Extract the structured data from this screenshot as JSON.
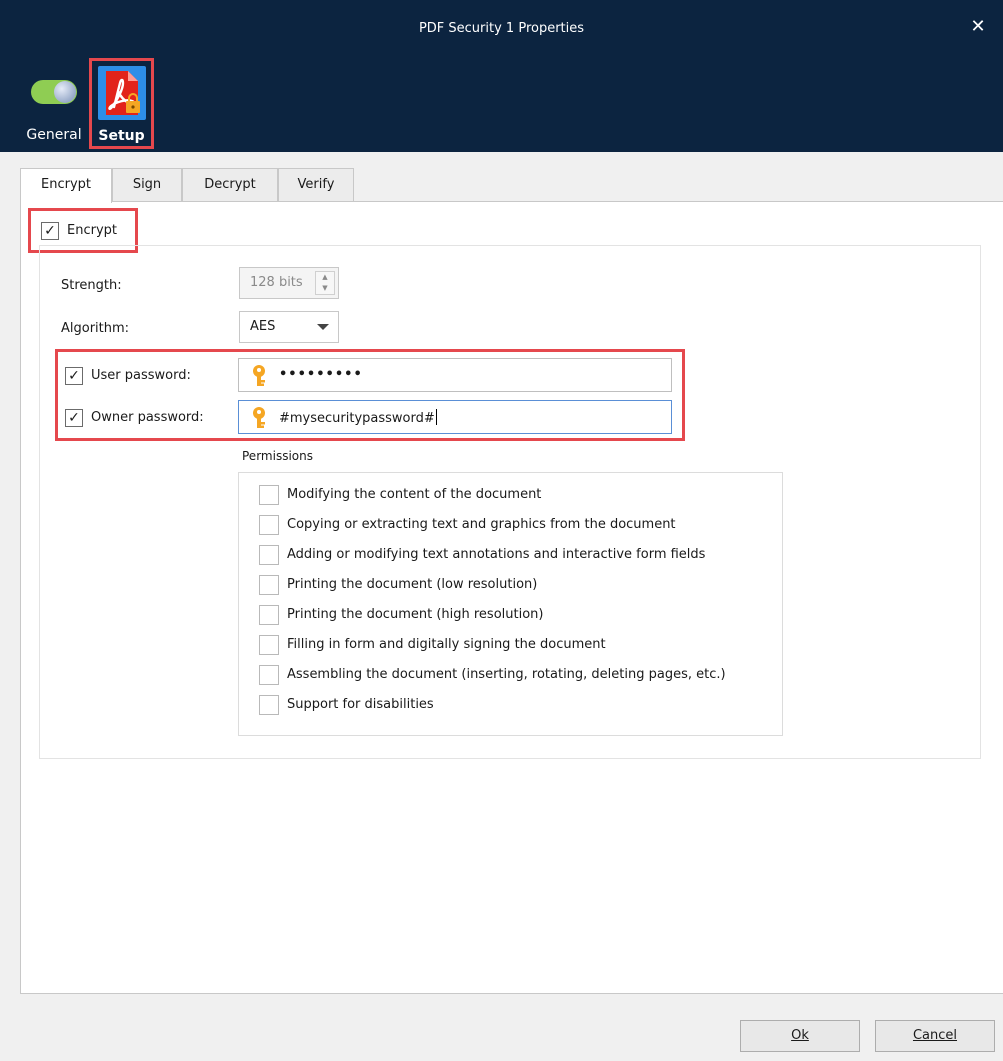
{
  "window": {
    "title": "PDF Security 1 Properties",
    "close_glyph": "✕"
  },
  "nav": {
    "general_label": "General",
    "setup_label": "Setup",
    "general_icon": "toggle-switch-icon",
    "setup_icon": "pdf-lock-icon"
  },
  "tabs": [
    {
      "label": "Encrypt",
      "active": true
    },
    {
      "label": "Sign",
      "active": false
    },
    {
      "label": "Decrypt",
      "active": false
    },
    {
      "label": "Verify",
      "active": false
    }
  ],
  "encrypt": {
    "checkbox_label": "Encrypt",
    "checked": true,
    "check_glyph": "✓",
    "strength_label": "Strength:",
    "strength_value": "128 bits",
    "algorithm_label": "Algorithm:",
    "algorithm_value": "AES",
    "user_password_label": "User password:",
    "user_password_checked": true,
    "user_password_value": "•••••••••",
    "owner_password_label": "Owner password:",
    "owner_password_checked": true,
    "owner_password_value": "#mysecuritypassword#",
    "key_icon": "key-icon"
  },
  "permissions": {
    "title": "Permissions",
    "items": [
      "Modifying the content of the document",
      "Copying or extracting text and graphics from the document",
      "Adding or modifying text annotations and interactive form fields",
      "Printing the document (low resolution)",
      "Printing the document (high resolution)",
      "Filling in form and digitally signing the document",
      "Assembling the document (inserting, rotating, deleting pages, etc.)",
      "Support for disabilities"
    ]
  },
  "footer": {
    "ok_label": "Ok",
    "cancel_label": "Cancel"
  },
  "colors": {
    "header_bg": "#0c2440",
    "highlight": "#e5484d",
    "toggle_green": "#8fcd53",
    "tile_blue": "#2d8ee8",
    "pdf_red": "#e2231a",
    "key_orange": "#f5a623"
  }
}
